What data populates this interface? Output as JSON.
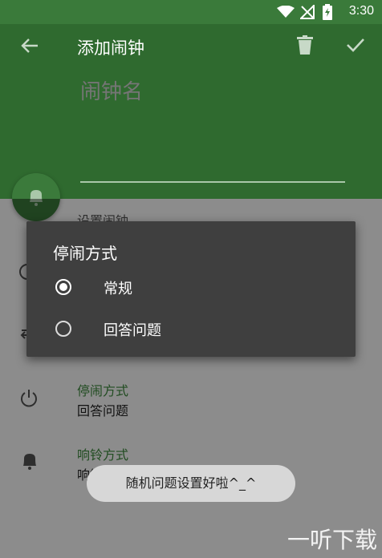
{
  "status_bar": {
    "time": "3:30"
  },
  "header": {
    "title": "添加闹钟",
    "name_placeholder": "闹钟名"
  },
  "list": {
    "partial_label": "设置闹钟",
    "stop_mode": {
      "label": "停闹方式",
      "value": "回答问题"
    },
    "ring_mode": {
      "label": "响铃方式",
      "value": "响铃"
    }
  },
  "dialog": {
    "title": "停闹方式",
    "options": [
      {
        "label": "常规",
        "selected": true
      },
      {
        "label": "回答问题",
        "selected": false
      }
    ]
  },
  "toast": {
    "text": "随机问题设置好啦^_^"
  },
  "watermark": {
    "text": "一听下载"
  },
  "colors": {
    "header": "#2f6a2f",
    "accent": "#3d8a3d",
    "dialog": "#3f3f3f"
  },
  "icons": [
    "wifi-icon",
    "signal-icon",
    "battery-icon",
    "back-arrow-icon",
    "trash-icon",
    "check-icon",
    "alarm-bell-icon",
    "clock-icon",
    "repeat-icon",
    "power-icon",
    "ringtone-bell-icon"
  ]
}
